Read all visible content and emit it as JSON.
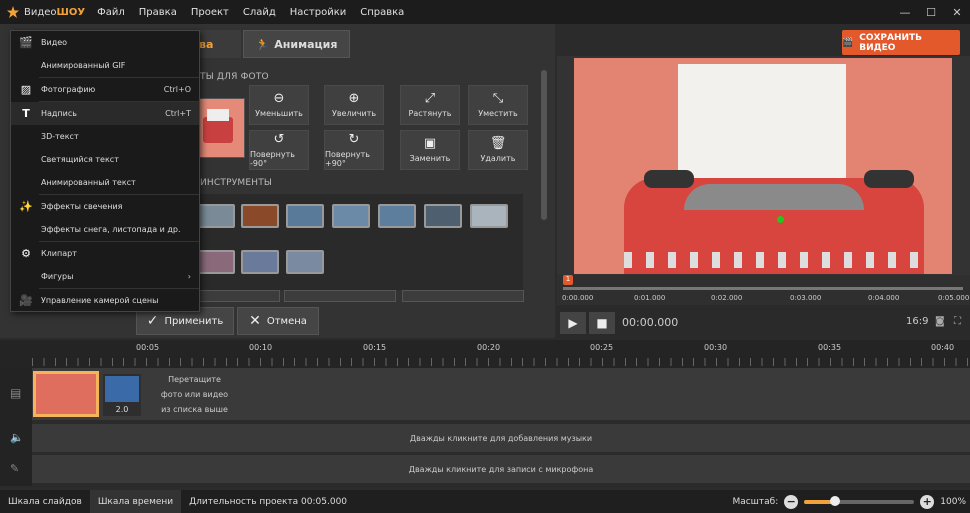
{
  "titlebar": {
    "app_name_prefix": "Видео",
    "app_name_suffix": "ШОУ",
    "menu": [
      "Файл",
      "Правка",
      "Проект",
      "Слайд",
      "Настройки",
      "Справка"
    ],
    "minimize": "—",
    "maximize": "☐",
    "close": "✕"
  },
  "save_button": {
    "label": "СОХРАНИТЬ ВИДЕО"
  },
  "tabs": {
    "active_label": "тва",
    "animation_label": "Анимация"
  },
  "sections": {
    "for_photo": "ТЫ ДЛЯ ФОТО",
    "tools": "ИНСТРУМЕНТЫ"
  },
  "tool_buttons": [
    {
      "label": "Уменьшить",
      "icon": "zoom-out-icon"
    },
    {
      "label": "Увеличить",
      "icon": "zoom-in-icon"
    },
    {
      "label": "Растянуть",
      "icon": "stretch-icon"
    },
    {
      "label": "Уместить",
      "icon": "fit-icon"
    },
    {
      "label": "Повернуть -90°",
      "icon": "rotate-left-icon"
    },
    {
      "label": "Повернуть +90°",
      "icon": "rotate-right-icon"
    },
    {
      "label": "Заменить",
      "icon": "replace-icon"
    },
    {
      "label": "Удалить",
      "icon": "trash-icon"
    }
  ],
  "actions": {
    "apply": "Применить",
    "cancel": "Отмена"
  },
  "preview_timeline": {
    "ticks": [
      "0:00.000",
      "0:01.000",
      "0:02.000",
      "0:03.000",
      "0:04.000",
      "0:05.000"
    ],
    "marker": "1"
  },
  "player": {
    "time": "00:00.000",
    "ratio": "16:9"
  },
  "timeline": {
    "ruler": [
      "00:05",
      "00:10",
      "00:15",
      "00:20",
      "00:25",
      "00:30",
      "00:35",
      "00:40"
    ],
    "slide2_duration": "2.0",
    "drop_hint": [
      "Перетащите",
      "фото или видео",
      "из списка выше"
    ],
    "music_hint": "Дважды кликните для добавления музыки",
    "mic_hint": "Дважды кликните для записи с микрофона"
  },
  "status": {
    "slides_scale": "Шкала слайдов",
    "time_scale": "Шкала времени",
    "duration": "Длительность проекта 00:05.000",
    "zoom_label": "Масштаб:",
    "zoom_value": "100%",
    "zoom_level": 0.28
  },
  "dropdown": [
    {
      "label": "Видео",
      "icon": "clapper-icon",
      "shortcut": ""
    },
    {
      "label": "Анимированный GIF",
      "icon": "",
      "shortcut": ""
    },
    {
      "label": "Фотографию",
      "icon": "image-icon",
      "shortcut": "Ctrl+O"
    },
    {
      "label": "Надпись",
      "icon": "text-icon",
      "shortcut": "Ctrl+T"
    },
    {
      "label": "3D-текст",
      "icon": "",
      "shortcut": ""
    },
    {
      "label": "Светящийся текст",
      "icon": "",
      "shortcut": ""
    },
    {
      "label": "Анимированный текст",
      "icon": "",
      "shortcut": ""
    },
    {
      "label": "Эффекты свечения",
      "icon": "sparkle-icon",
      "shortcut": ""
    },
    {
      "label": "Эффекты снега, листопада и др.",
      "icon": "",
      "shortcut": ""
    },
    {
      "label": "Клипарт",
      "icon": "gear-icon",
      "shortcut": ""
    },
    {
      "label": "Фигуры",
      "icon": "",
      "shortcut": "›"
    },
    {
      "label": "Управление камерой сцены",
      "icon": "camera-icon",
      "shortcut": ""
    }
  ]
}
